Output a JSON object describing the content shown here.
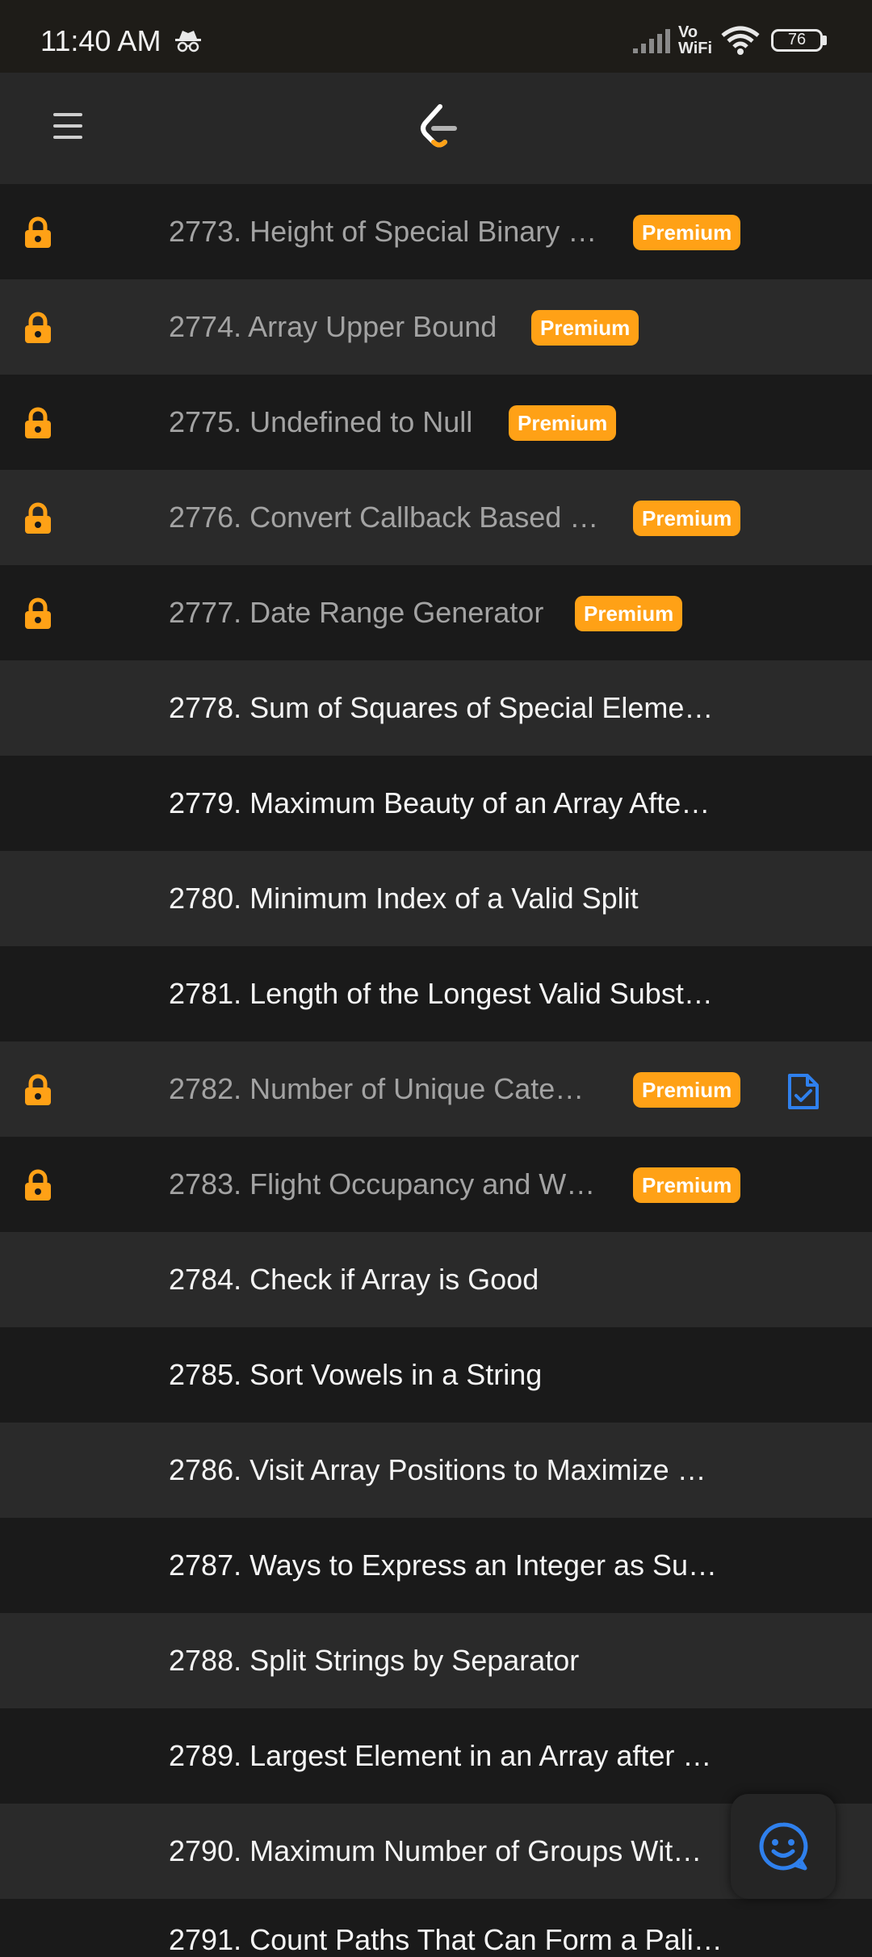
{
  "status_bar": {
    "time": "11:40 AM",
    "network_label_top": "Vo",
    "network_label_bottom": "WiFi",
    "battery": "76"
  },
  "colors": {
    "accent": "#ffa116",
    "premium_badge": "#ffa116",
    "solution_icon": "#2f80ed",
    "row_dark": "#1a1a1a",
    "row_light": "#2a2a2a"
  },
  "problems": [
    {
      "title": "2773. Height of Special Binary …",
      "premium": "Premium",
      "locked": true
    },
    {
      "title": "2774. Array Upper Bound",
      "premium": "Premium",
      "locked": true
    },
    {
      "title": "2775. Undefined to Null",
      "premium": "Premium",
      "locked": true
    },
    {
      "title": "2776. Convert Callback Based …",
      "premium": "Premium",
      "locked": true
    },
    {
      "title": "2777. Date Range Generator",
      "premium": "Premium",
      "locked": true
    },
    {
      "title": "2778. Sum of Squares of Special Eleme…",
      "premium": "",
      "locked": false
    },
    {
      "title": "2779. Maximum Beauty of an Array Afte…",
      "premium": "",
      "locked": false
    },
    {
      "title": "2780. Minimum Index of a Valid Split",
      "premium": "",
      "locked": false
    },
    {
      "title": "2781. Length of the Longest Valid Subst…",
      "premium": "",
      "locked": false
    },
    {
      "title": "2782. Number of Unique Cate…",
      "premium": "Premium",
      "locked": true,
      "icon": "solution-document-icon"
    },
    {
      "title": "2783. Flight Occupancy and W…",
      "premium": "Premium",
      "locked": true
    },
    {
      "title": "2784. Check if Array is Good",
      "premium": "",
      "locked": false
    },
    {
      "title": "2785. Sort Vowels in a String",
      "premium": "",
      "locked": false
    },
    {
      "title": "2786. Visit Array Positions to Maximize …",
      "premium": "",
      "locked": false
    },
    {
      "title": "2787. Ways to Express an Integer as Su…",
      "premium": "",
      "locked": false
    },
    {
      "title": "2788. Split Strings by Separator",
      "premium": "",
      "locked": false
    },
    {
      "title": "2789. Largest Element in an Array after …",
      "premium": "",
      "locked": false
    },
    {
      "title": "2790. Maximum Number of Groups Wit…",
      "premium": "",
      "locked": false
    }
  ],
  "partial_row": "2791. Count Paths That Can Form a Pali…"
}
